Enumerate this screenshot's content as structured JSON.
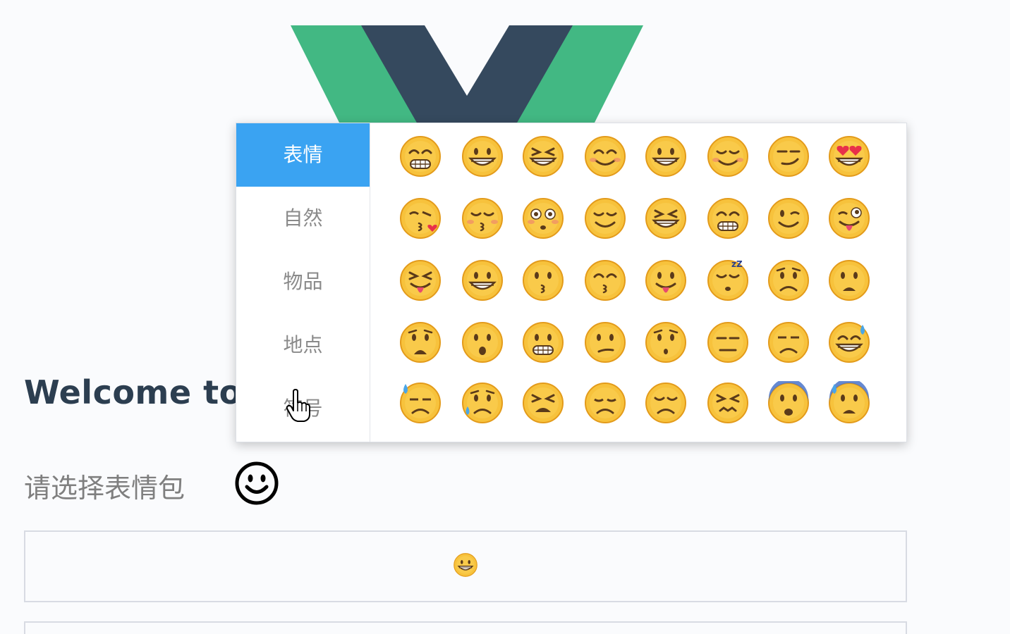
{
  "header": {
    "welcome_text": "Welcome to"
  },
  "picker_label": "请选择表情包",
  "trigger_icon": "smile-outline-icon",
  "picker": {
    "tabs": [
      {
        "label": "表情",
        "active": true
      },
      {
        "label": "自然",
        "active": false
      },
      {
        "label": "物品",
        "active": false
      },
      {
        "label": "地点",
        "active": false
      },
      {
        "label": "符号",
        "active": false
      }
    ],
    "emojis": [
      [
        "grimace-mustache",
        "grin",
        "laugh-squint",
        "blush-smile",
        "smiley",
        "relaxed",
        "smirk",
        "heart-eyes"
      ],
      [
        "kiss-heart",
        "kiss-closed-eyes",
        "flushed",
        "relieved",
        "laugh-squint-2",
        "grimace",
        "wink",
        "tongue-wink"
      ],
      [
        "tongue-squint",
        "grin-2",
        "kissing",
        "kissing-smile",
        "tongue",
        "sleeping",
        "worried",
        "frowning-open"
      ],
      [
        "anguished",
        "open-mouth",
        "grimacing-teeth",
        "confused",
        "hushed",
        "expressionless",
        "unamused",
        "sweat-smile"
      ],
      [
        "downcast-sweat",
        "disappointed-relieved",
        "weary",
        "pensive",
        "disappointed",
        "confounded",
        "fearful",
        "cold-sweat"
      ]
    ]
  },
  "output": {
    "selected_emoji": "grin"
  },
  "colors": {
    "vue_green": "#42b883",
    "vue_dark": "#35495e",
    "tab_active": "#3aa3f2",
    "emoji_yellow": "#f7c23c"
  }
}
